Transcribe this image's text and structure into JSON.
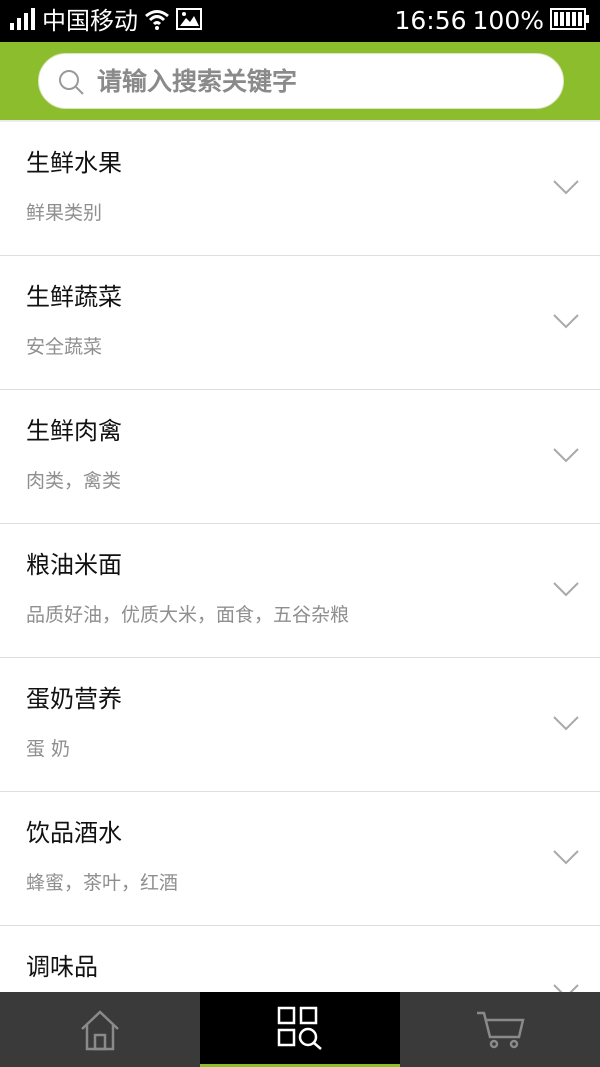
{
  "status_bar": {
    "carrier": "中国移动",
    "time": "16:56",
    "battery": "100%"
  },
  "search": {
    "placeholder": "请输入搜索关键字",
    "value": ""
  },
  "categories": [
    {
      "title": "生鲜水果",
      "subtitle": "鲜果类别"
    },
    {
      "title": "生鲜蔬菜",
      "subtitle": "安全蔬菜"
    },
    {
      "title": "生鲜肉禽",
      "subtitle": "肉类，禽类"
    },
    {
      "title": "粮油米面",
      "subtitle": "品质好油，优质大米，面食，五谷杂粮"
    },
    {
      "title": "蛋奶营养",
      "subtitle": "蛋 奶"
    },
    {
      "title": "饮品酒水",
      "subtitle": "蜂蜜，茶叶，红酒"
    },
    {
      "title": "调味品",
      "subtitle": ""
    }
  ],
  "tabs": [
    {
      "icon": "home-icon",
      "active": false
    },
    {
      "icon": "category-search-icon",
      "active": true
    },
    {
      "icon": "cart-icon",
      "active": false
    }
  ],
  "colors": {
    "accent": "#8bbd2c",
    "tabbar": "#3a3a3a",
    "tab_active": "#000000",
    "subtitle": "#8f8f8f"
  }
}
